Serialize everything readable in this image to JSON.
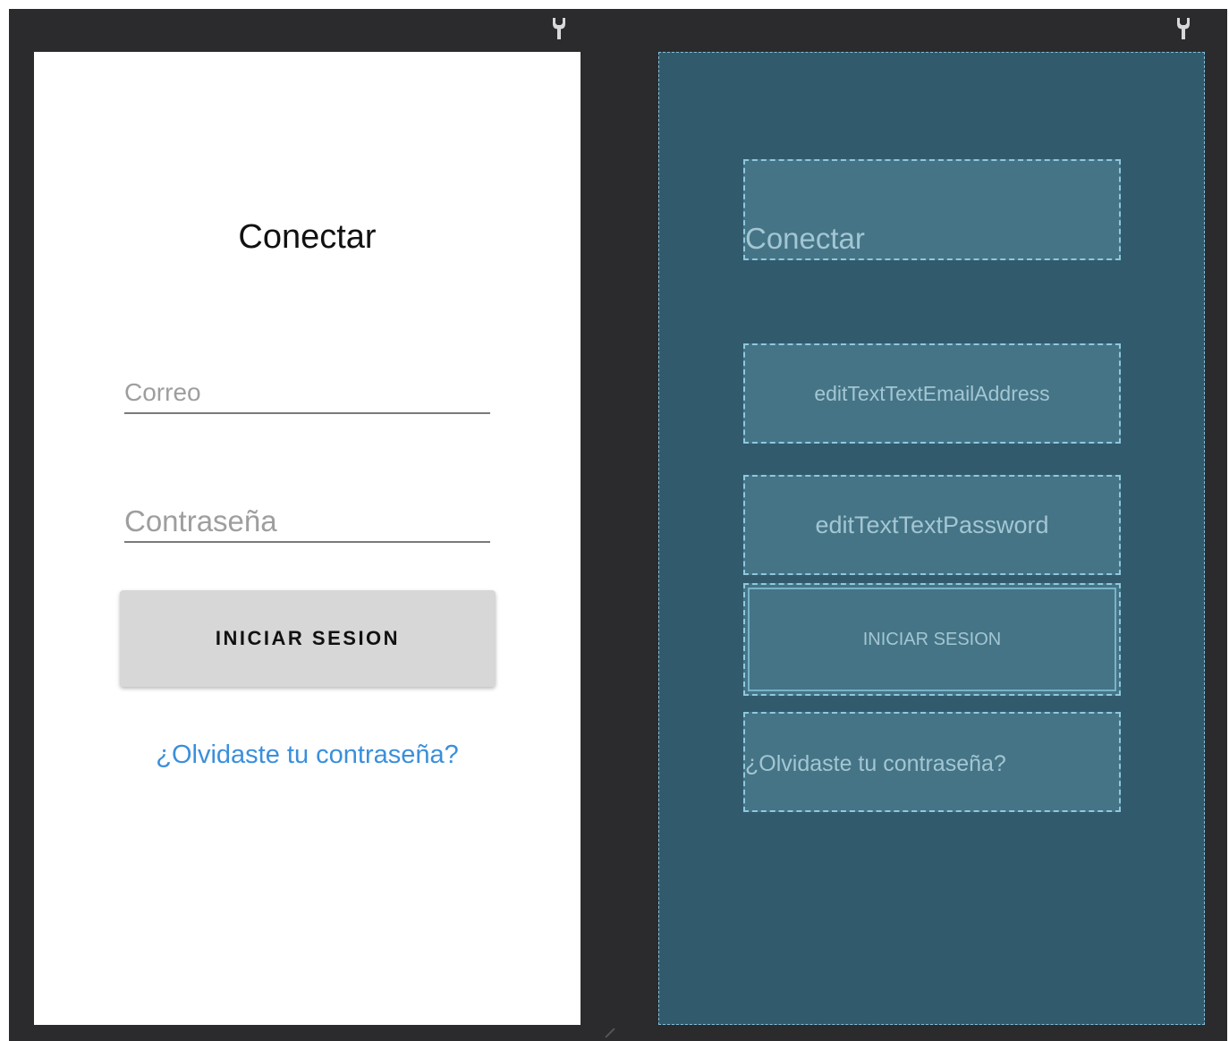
{
  "design": {
    "title": "Conectar",
    "email_placeholder": "Correo",
    "password_placeholder": "Contraseña",
    "login_button": "INICIAR SESION",
    "forgot_link": "¿Olvidaste tu contraseña?"
  },
  "blueprint": {
    "title": "Conectar",
    "email_id": "editTextTextEmailAddress",
    "password_id": "editTextTextPassword",
    "login_button": "INICIAR SESION",
    "forgot_link": "¿Olvidaste tu contraseña?"
  },
  "icons": {
    "toolbar": "wrench-icon"
  },
  "colors": {
    "editor_bg": "#2b2b2d",
    "link": "#3a8fdc",
    "button_bg": "#d7d7d7",
    "blueprint_bg": "#325a6d",
    "blueprint_widget": "#457486"
  }
}
